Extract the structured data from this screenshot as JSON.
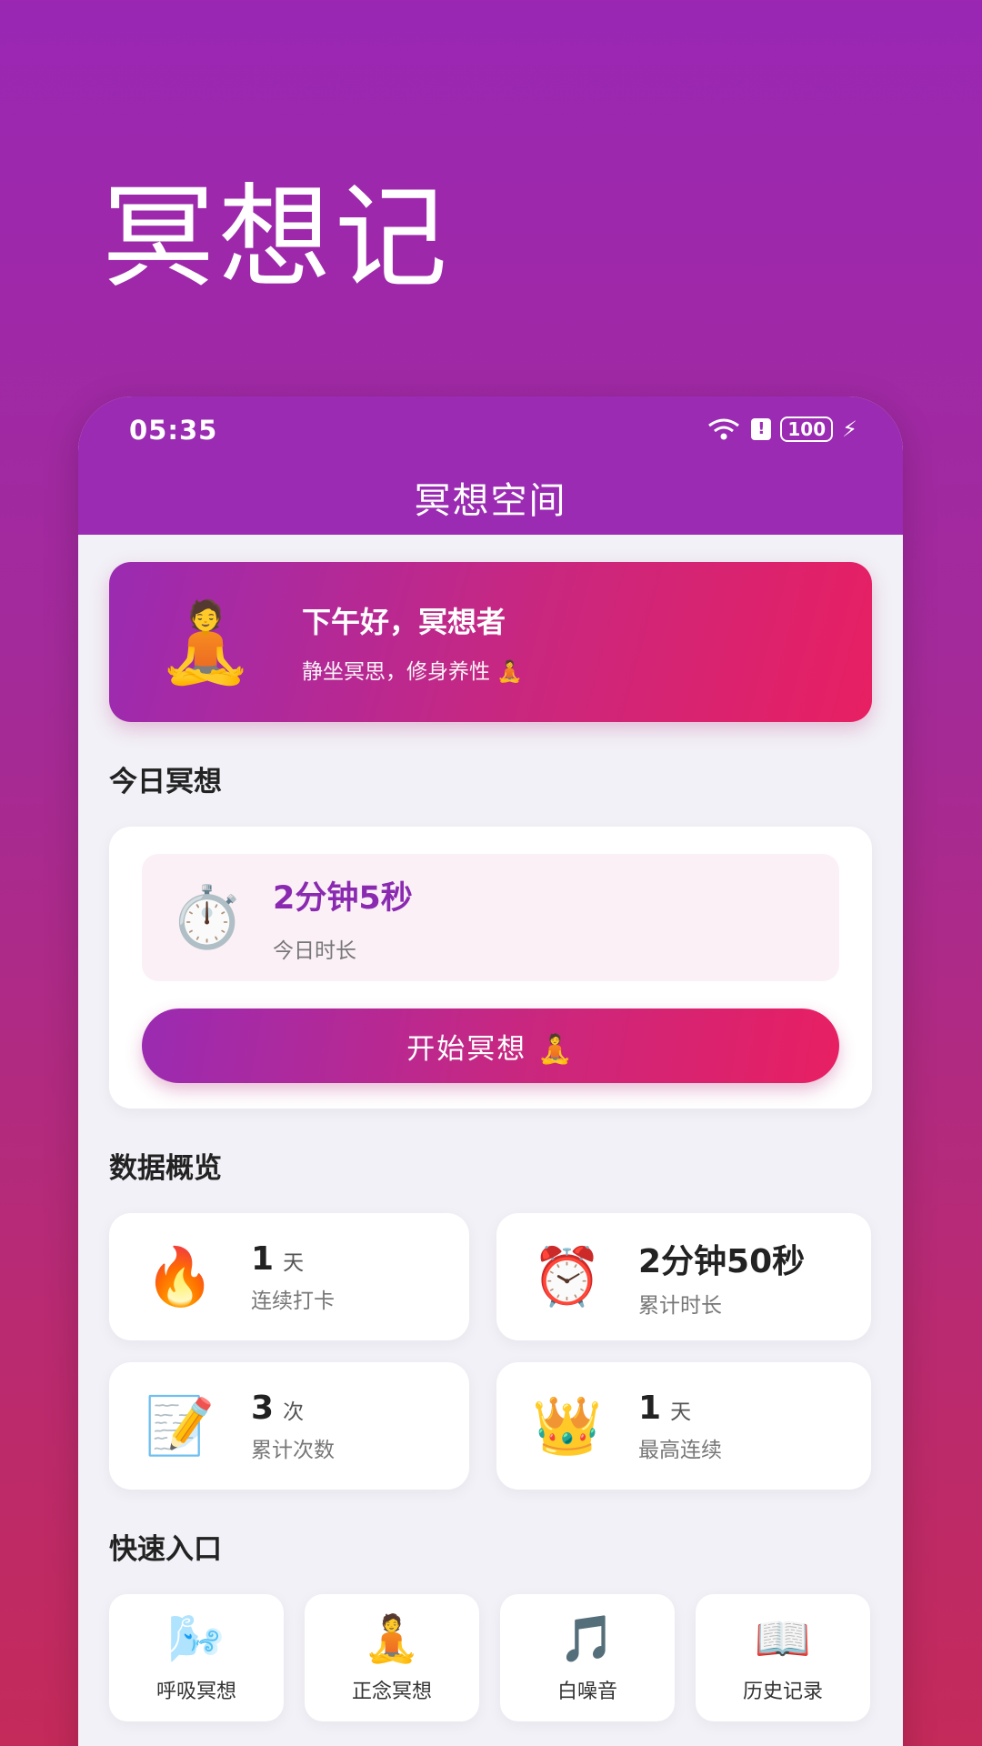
{
  "hero": {
    "title": "冥想记"
  },
  "status_bar": {
    "time": "05:35",
    "battery": "100"
  },
  "app": {
    "title": "冥想空间"
  },
  "greeting": {
    "emoji": "🧘",
    "title": "下午好，冥想者",
    "subtitle": "静坐冥思，修身养性 🧘"
  },
  "today": {
    "section_title": "今日冥想",
    "emoji": "⏱️",
    "duration": "2分钟5秒",
    "label": "今日时长",
    "start_button": "开始冥想 🧘"
  },
  "overview": {
    "section_title": "数据概览",
    "stats": [
      {
        "emoji": "🔥",
        "value": "1",
        "unit": "天",
        "label": "连续打卡"
      },
      {
        "emoji": "⏰",
        "value": "2分钟50秒",
        "unit": "",
        "label": "累计时长"
      },
      {
        "emoji": "📝",
        "value": "3",
        "unit": "次",
        "label": "累计次数"
      },
      {
        "emoji": "👑",
        "value": "1",
        "unit": "天",
        "label": "最高连续"
      }
    ]
  },
  "quick": {
    "section_title": "快速入口",
    "items": [
      {
        "emoji": "🌬️",
        "label": "呼吸冥想"
      },
      {
        "emoji": "🧘",
        "label": "正念冥想"
      },
      {
        "emoji": "🎵",
        "label": "白噪音"
      },
      {
        "emoji": "📖",
        "label": "历史记录"
      }
    ]
  },
  "colors": {
    "primary": "#9a2bb2",
    "accent": "#e81f62",
    "background": "#f2f1f7"
  }
}
